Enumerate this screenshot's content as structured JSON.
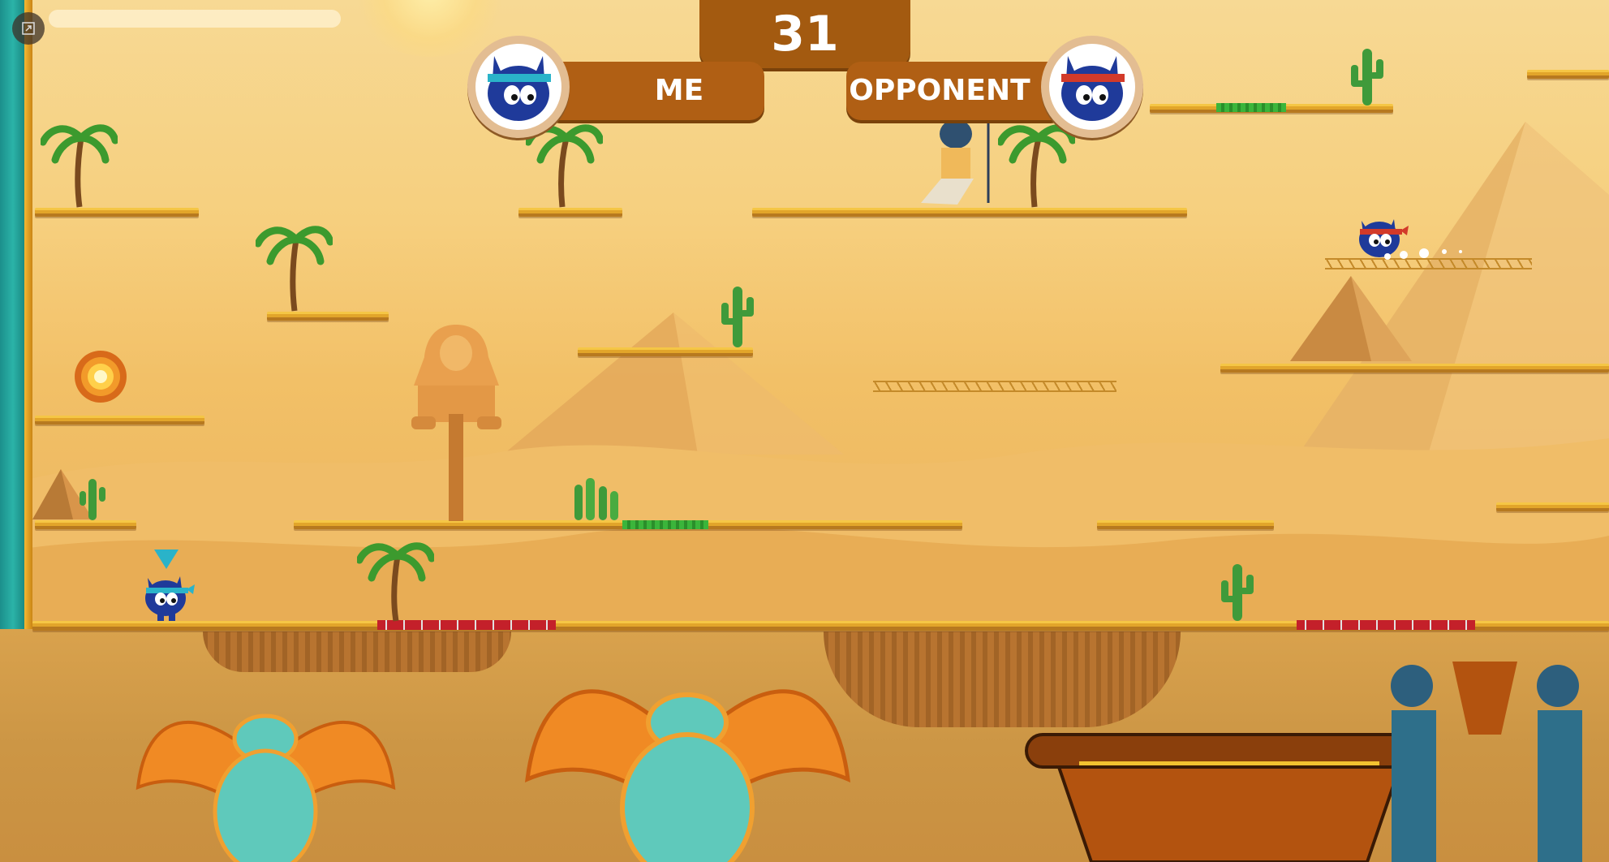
{
  "hud": {
    "timer": "31",
    "me_label": "ME",
    "opponent_label": "OPPONENT"
  },
  "colors": {
    "hud_brown": "#a35a10",
    "player_me_headband": "#2ab3c9",
    "player_opponent_headband": "#d23a2a",
    "platform_gold": "#e2a52a"
  },
  "icons": {
    "expand": "expand-icon",
    "me_avatar": "blue-cat-cyan-headband",
    "opponent_avatar": "blue-cat-red-headband",
    "portal": "swirl-portal-icon",
    "player_marker": "triangle-down-marker"
  }
}
